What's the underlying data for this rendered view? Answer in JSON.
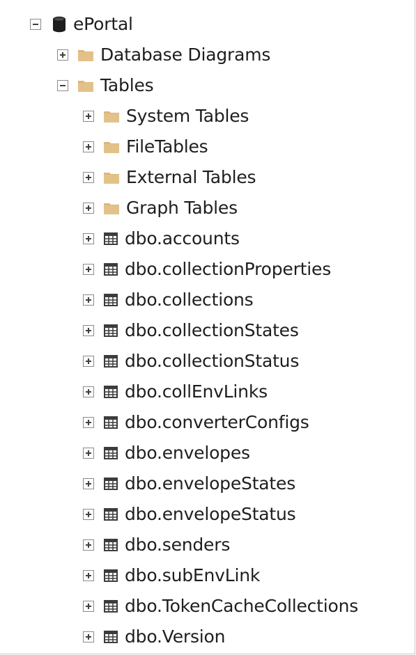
{
  "tree": {
    "root": {
      "label": "ePortal",
      "icon": "database-icon",
      "expanded": true
    },
    "level1": [
      {
        "label": "Database Diagrams",
        "icon": "folder-icon",
        "expanded": false
      },
      {
        "label": "Tables",
        "icon": "folder-icon",
        "expanded": true
      }
    ],
    "tables_children": [
      {
        "label": "System Tables",
        "icon": "folder-icon"
      },
      {
        "label": "FileTables",
        "icon": "folder-icon"
      },
      {
        "label": "External Tables",
        "icon": "folder-icon"
      },
      {
        "label": "Graph Tables",
        "icon": "folder-icon"
      },
      {
        "label": "dbo.accounts",
        "icon": "table-icon"
      },
      {
        "label": "dbo.collectionProperties",
        "icon": "table-icon"
      },
      {
        "label": "dbo.collections",
        "icon": "table-icon"
      },
      {
        "label": "dbo.collectionStates",
        "icon": "table-icon"
      },
      {
        "label": "dbo.collectionStatus",
        "icon": "table-icon"
      },
      {
        "label": "dbo.collEnvLinks",
        "icon": "table-icon"
      },
      {
        "label": "dbo.converterConfigs",
        "icon": "table-icon"
      },
      {
        "label": "dbo.envelopes",
        "icon": "table-icon"
      },
      {
        "label": "dbo.envelopeStates",
        "icon": "table-icon"
      },
      {
        "label": "dbo.envelopeStatus",
        "icon": "table-icon"
      },
      {
        "label": "dbo.senders",
        "icon": "table-icon"
      },
      {
        "label": "dbo.subEnvLink",
        "icon": "table-icon"
      },
      {
        "label": "dbo.TokenCacheCollections",
        "icon": "table-icon"
      },
      {
        "label": "dbo.Version",
        "icon": "table-icon"
      }
    ]
  },
  "colors": {
    "folder": "#dcb67a",
    "folder_dark": "#c9a463",
    "database": "#1e1e1e",
    "table_icon": "#3c3c3c",
    "text": "#1e1e1e",
    "toggle_border": "#8a8a8a",
    "frame_border": "#c8c8c8"
  }
}
